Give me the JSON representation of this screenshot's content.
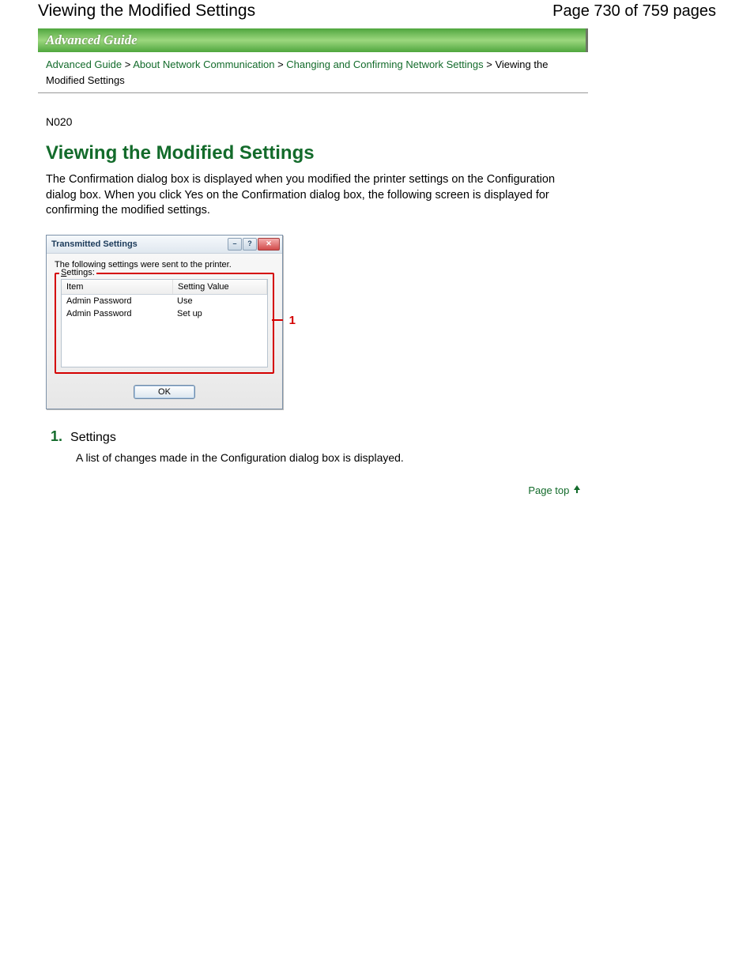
{
  "header": {
    "title": "Viewing the Modified Settings",
    "page_indicator": "Page 730 of 759 pages"
  },
  "banner": "Advanced Guide",
  "breadcrumb": {
    "link1": "Advanced Guide",
    "link2": "About Network Communication",
    "link3": "Changing and Confirming Network Settings",
    "current": "Viewing the Modified Settings",
    "sep": ">"
  },
  "doc_code": "N020",
  "title": "Viewing the Modified Settings",
  "intro": "The Confirmation dialog box is displayed when you modified the printer settings on the Configuration dialog box. When you click Yes on the Confirmation dialog box, the following screen is displayed for confirming the modified settings.",
  "dialog": {
    "title": "Transmitted Settings",
    "message": "The following settings were sent to the printer.",
    "group_label": "Settings:",
    "columns": {
      "c1": "Item",
      "c2": "Setting Value"
    },
    "rows": [
      {
        "item": "Admin Password",
        "value": "Use"
      },
      {
        "item": "Admin Password",
        "value": "Set up"
      }
    ],
    "ok": "OK",
    "callout": "1"
  },
  "section": {
    "num": "1.",
    "title": "Settings",
    "body": "A list of changes made in the Configuration dialog box is displayed."
  },
  "pagetop": "Page top"
}
